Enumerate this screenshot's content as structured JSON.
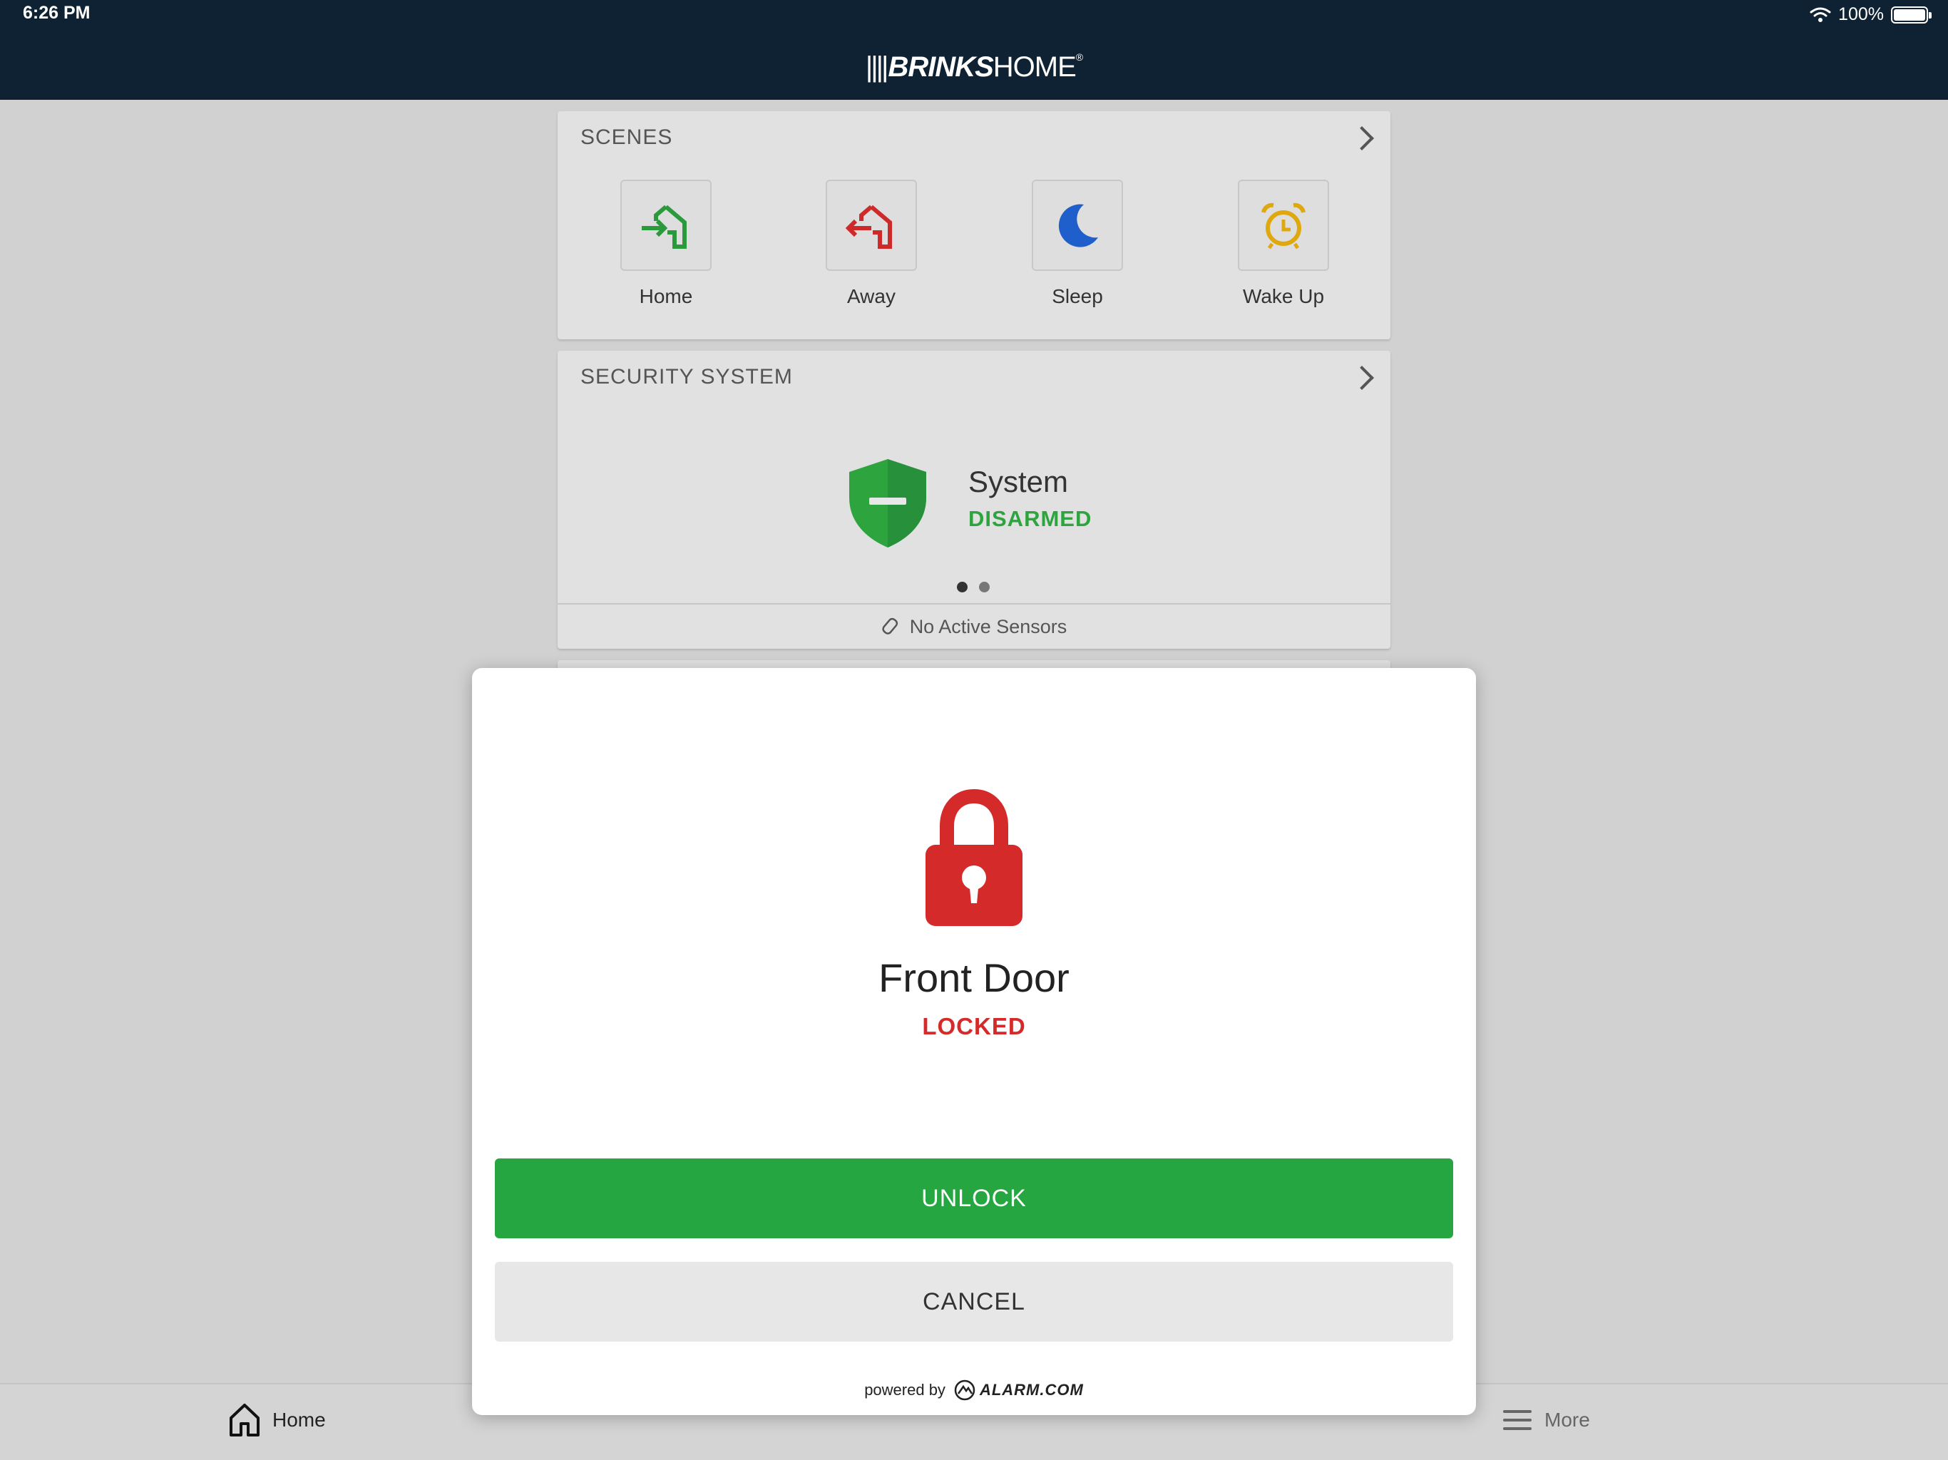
{
  "status_bar": {
    "time": "6:26 PM",
    "battery": "100%"
  },
  "header": {
    "logo_bars": "||||",
    "logo_brand": "BRINKS",
    "logo_home": "HOME",
    "logo_reg": "®"
  },
  "scenes": {
    "title": "SCENES",
    "items": [
      {
        "label": "Home",
        "icon": "home-arrive-icon",
        "color": "#2a9a3c"
      },
      {
        "label": "Away",
        "icon": "home-leave-icon",
        "color": "#cf2a2a"
      },
      {
        "label": "Sleep",
        "icon": "moon-icon",
        "color": "#1f5fcc"
      },
      {
        "label": "Wake Up",
        "icon": "alarm-clock-icon",
        "color": "#e0a80f"
      }
    ]
  },
  "security": {
    "title": "SECURITY SYSTEM",
    "system_name": "System",
    "system_state": "DISARMED",
    "sensors_text": "No Active Sensors"
  },
  "modal": {
    "device_name": "Front Door",
    "device_state": "LOCKED",
    "unlock_label": "UNLOCK",
    "cancel_label": "CANCEL",
    "powered_by": "powered by",
    "powered_brand": "ALARM.COM"
  },
  "bottom_nav": {
    "home_label": "Home",
    "more_label": "More"
  },
  "colors": {
    "header_bg": "#0f2233",
    "green": "#25a641",
    "red": "#d52a2a"
  }
}
